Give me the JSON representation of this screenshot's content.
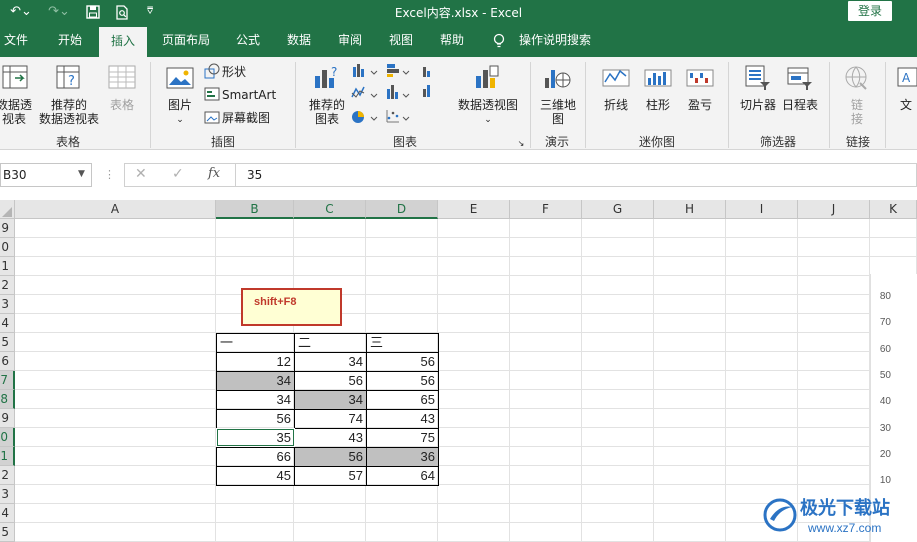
{
  "title_bar": {
    "title": "Excel内容.xlsx  -  Excel",
    "login": "登录"
  },
  "tabs": [
    {
      "label": "文件"
    },
    {
      "label": "开始"
    },
    {
      "label": "插入"
    },
    {
      "label": "页面布局"
    },
    {
      "label": "公式"
    },
    {
      "label": "数据"
    },
    {
      "label": "审阅"
    },
    {
      "label": "视图"
    },
    {
      "label": "帮助"
    },
    {
      "label": "操作说明搜索"
    }
  ],
  "ribbon": {
    "pivot": "数据透\n视表",
    "recommended_pivot": "推荐的\n数据透视表",
    "table": "表格",
    "group_tables": "表格",
    "pictures": "图片",
    "shapes": "形状",
    "smartart": "SmartArt",
    "screenshot": "屏幕截图",
    "group_illustrations": "插图",
    "recommended_charts": "推荐的\n图表",
    "pivot_chart": "数据透视图",
    "group_charts": "图表",
    "map3d": "三维地\n图",
    "group_tours": "演示",
    "line": "折线",
    "column": "柱形",
    "winloss": "盈亏",
    "group_sparklines": "迷你图",
    "slicer": "切片器",
    "timeline": "日程表",
    "group_filters": "筛选器",
    "link": "链\n接",
    "group_links": "链接",
    "text": "文"
  },
  "formula_bar": {
    "name_box": "B30",
    "formula": "35"
  },
  "columns": [
    "A",
    "B",
    "C",
    "D",
    "E",
    "F",
    "G",
    "H",
    "I",
    "J",
    "K"
  ],
  "rows": [
    "9",
    "0",
    "1",
    "2",
    "3",
    "4",
    "5",
    "6",
    "7",
    "8",
    "9",
    "0",
    "1",
    "2",
    "3",
    "4",
    "5"
  ],
  "note_box": "shift+F8",
  "table": {
    "headers": [
      "一",
      "二",
      "三"
    ],
    "rows": [
      [
        "12",
        "34",
        "56"
      ],
      [
        "34",
        "56",
        "56"
      ],
      [
        "34",
        "34",
        "65"
      ],
      [
        "56",
        "74",
        "43"
      ],
      [
        "35",
        "43",
        "75"
      ],
      [
        "66",
        "56",
        "36"
      ],
      [
        "45",
        "57",
        "64"
      ]
    ]
  },
  "chart_axis": [
    "80",
    "70",
    "60",
    "50",
    "40",
    "30",
    "20",
    "10"
  ],
  "watermark": {
    "brand": "极光下载站",
    "url": "www.xz7.com"
  }
}
